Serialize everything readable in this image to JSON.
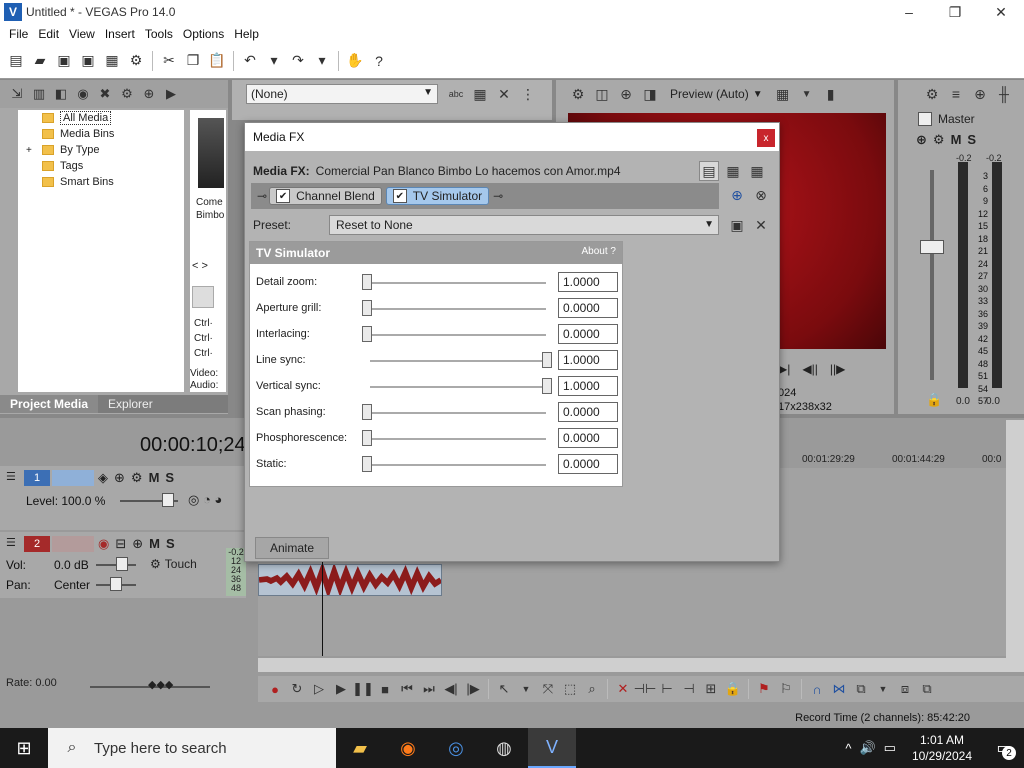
{
  "window": {
    "title": "Untitled * - VEGAS Pro 14.0",
    "logo_letter": "V",
    "minimize": "–",
    "restore": "❐",
    "close": "✕"
  },
  "menu": [
    "File",
    "Edit",
    "View",
    "Insert",
    "Tools",
    "Options",
    "Help"
  ],
  "project_media": {
    "tree": [
      {
        "label": "All Media",
        "selected": true,
        "expander": ""
      },
      {
        "label": "Media Bins",
        "selected": false,
        "expander": ""
      },
      {
        "label": "By Type",
        "selected": false,
        "expander": "+"
      },
      {
        "label": "Tags",
        "selected": false,
        "expander": ""
      },
      {
        "label": "Smart Bins",
        "selected": false,
        "expander": ""
      }
    ],
    "thumb_label": [
      "Come",
      "Bimbo"
    ],
    "ctrl_labels": [
      "Ctrl·",
      "Ctrl·",
      "Ctrl·"
    ],
    "thumb_bottom": [
      "Video:",
      "Audio:"
    ],
    "tabs": [
      "Project Media",
      "Explorer"
    ]
  },
  "fx_dropdown": {
    "value": "(None)"
  },
  "preview": {
    "mode": "Preview (Auto)",
    "info_lines": [
      "024",
      "17x238x32"
    ]
  },
  "master": {
    "label": "Master",
    "db_top": [
      "-0.2",
      "-0.2"
    ],
    "scale": [
      "3",
      "6",
      "9",
      "12",
      "15",
      "18",
      "21",
      "24",
      "27",
      "30",
      "33",
      "36",
      "39",
      "42",
      "45",
      "48",
      "51",
      "54",
      "57"
    ],
    "db_bottom": [
      "0.0",
      "0.0"
    ]
  },
  "timeline": {
    "timecode": "00:00:10;24",
    "ruler": [
      "00:01:29:29",
      "00:01:44:29",
      "00:0"
    ],
    "track1": {
      "num": "1",
      "level": "Level: 100.0 %"
    },
    "track2": {
      "num": "2",
      "vol_label": "Vol:",
      "vol_value": "0.0 dB",
      "pan_label": "Pan:",
      "pan_value": "Center",
      "touch": "Touch",
      "meter_vals": [
        "-0.2",
        "12",
        "24",
        "36",
        "48"
      ]
    },
    "rate": "Rate: 0.00"
  },
  "status": {
    "record_time": "Record Time (2 channels): 85:42:20"
  },
  "dialog": {
    "title": "Media FX",
    "close": "x",
    "header_label": "Media FX:",
    "header_file": "Comercial Pan Blanco Bimbo Lo hacemos con Amor.mp4",
    "chain": [
      {
        "label": "Channel Blend",
        "active": false
      },
      {
        "label": "TV Simulator",
        "active": true
      }
    ],
    "preset_label": "Preset:",
    "preset_value": "Reset to None",
    "plugin_title": "TV Simulator",
    "about": "About  ?",
    "params": [
      {
        "label": "Detail zoom:",
        "value": "1.0000",
        "pos": 0
      },
      {
        "label": "Aperture grill:",
        "value": "0.0000",
        "pos": 0
      },
      {
        "label": "Interlacing:",
        "value": "0.0000",
        "pos": 0
      },
      {
        "label": "Line sync:",
        "value": "1.0000",
        "pos": 1
      },
      {
        "label": "Vertical sync:",
        "value": "1.0000",
        "pos": 1
      },
      {
        "label": "Scan phasing:",
        "value": "0.0000",
        "pos": 0
      },
      {
        "label": "Phosphorescence:",
        "value": "0.0000",
        "pos": 0
      },
      {
        "label": "Static:",
        "value": "0.0000",
        "pos": 0
      }
    ],
    "animate_label": "Animate"
  },
  "taskbar": {
    "search_placeholder": "Type here to search",
    "time": "1:01 AM",
    "date": "10/29/2024",
    "notif_count": "2"
  },
  "colors": {
    "accent": "#a5c8ec",
    "close_red": "#c8252c",
    "track1": "#3c6fb5",
    "track2": "#a52a2a",
    "video_red": "#b3131a"
  }
}
